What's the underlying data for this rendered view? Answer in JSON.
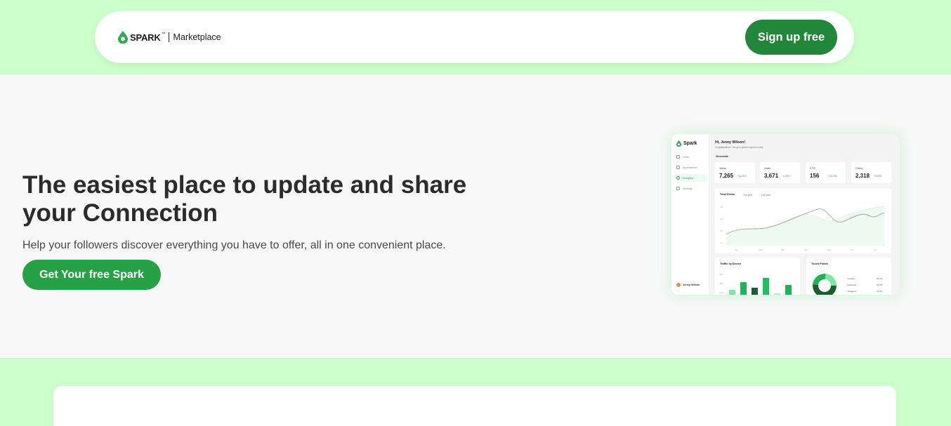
{
  "header": {
    "brand": "SPARK",
    "brand_tm": "™",
    "brand_sub": "Marketplace",
    "signup_label": "Sign up free"
  },
  "hero": {
    "title_line1": "The easiest place to update and share",
    "title_line2": "your Connection",
    "subtitle": "Help your followers discover everything you have to offer, all in one convenient place.",
    "cta_label": "Get Your free Spark"
  },
  "dashboard": {
    "brand": "Spark",
    "nav": [
      "Links",
      "Appearance",
      "Analytics",
      "Settings"
    ],
    "active_nav": "Analytics",
    "user": "Jenny Wilson",
    "greeting": "Hi, Jenny Wilson!",
    "greeting_sub": "Congratulations, You got a great response today.",
    "overview_label": "Overview",
    "stats": [
      {
        "label": "Views",
        "value": "7,265",
        "change": "+11.01%"
      },
      {
        "label": "Visits",
        "value": "3,671",
        "change": "-0.03%"
      },
      {
        "label": "CTR",
        "value": "156",
        "change": "+15.03%"
      },
      {
        "label": "Clicks",
        "value": "2,318",
        "change": "+6.08%"
      }
    ],
    "total_clicks": {
      "title": "Total Clicks",
      "legend": [
        "This year",
        "Last year"
      ],
      "months": [
        "Jan",
        "Feb",
        "Mar",
        "Apr",
        "May",
        "Jun",
        "Jul"
      ],
      "y_ticks": [
        "30",
        "20",
        "10",
        "0"
      ]
    },
    "traffic": {
      "title": "Traffic by Device",
      "y_ticks": [
        "30K",
        "20K",
        "10K"
      ],
      "bars": [
        0.25,
        0.55,
        0.35,
        0.7,
        0.12,
        0.45
      ],
      "colors": [
        "#7ee6a5",
        "#22b15a",
        "#1e5c34",
        "#1fbe5f",
        "#a6f0c2",
        "#22b15a"
      ]
    },
    "touch_points": {
      "title": "Touch Points",
      "items": [
        {
          "label": "Youtube",
          "value": "52.1%"
        },
        {
          "label": "Facebook",
          "value": "22.8%"
        },
        {
          "label": "Instagram",
          "value": "13.9%"
        }
      ]
    }
  },
  "colors": {
    "band": "#ccffc9",
    "brand_green": "#23873b",
    "cta_green": "#27a146"
  }
}
